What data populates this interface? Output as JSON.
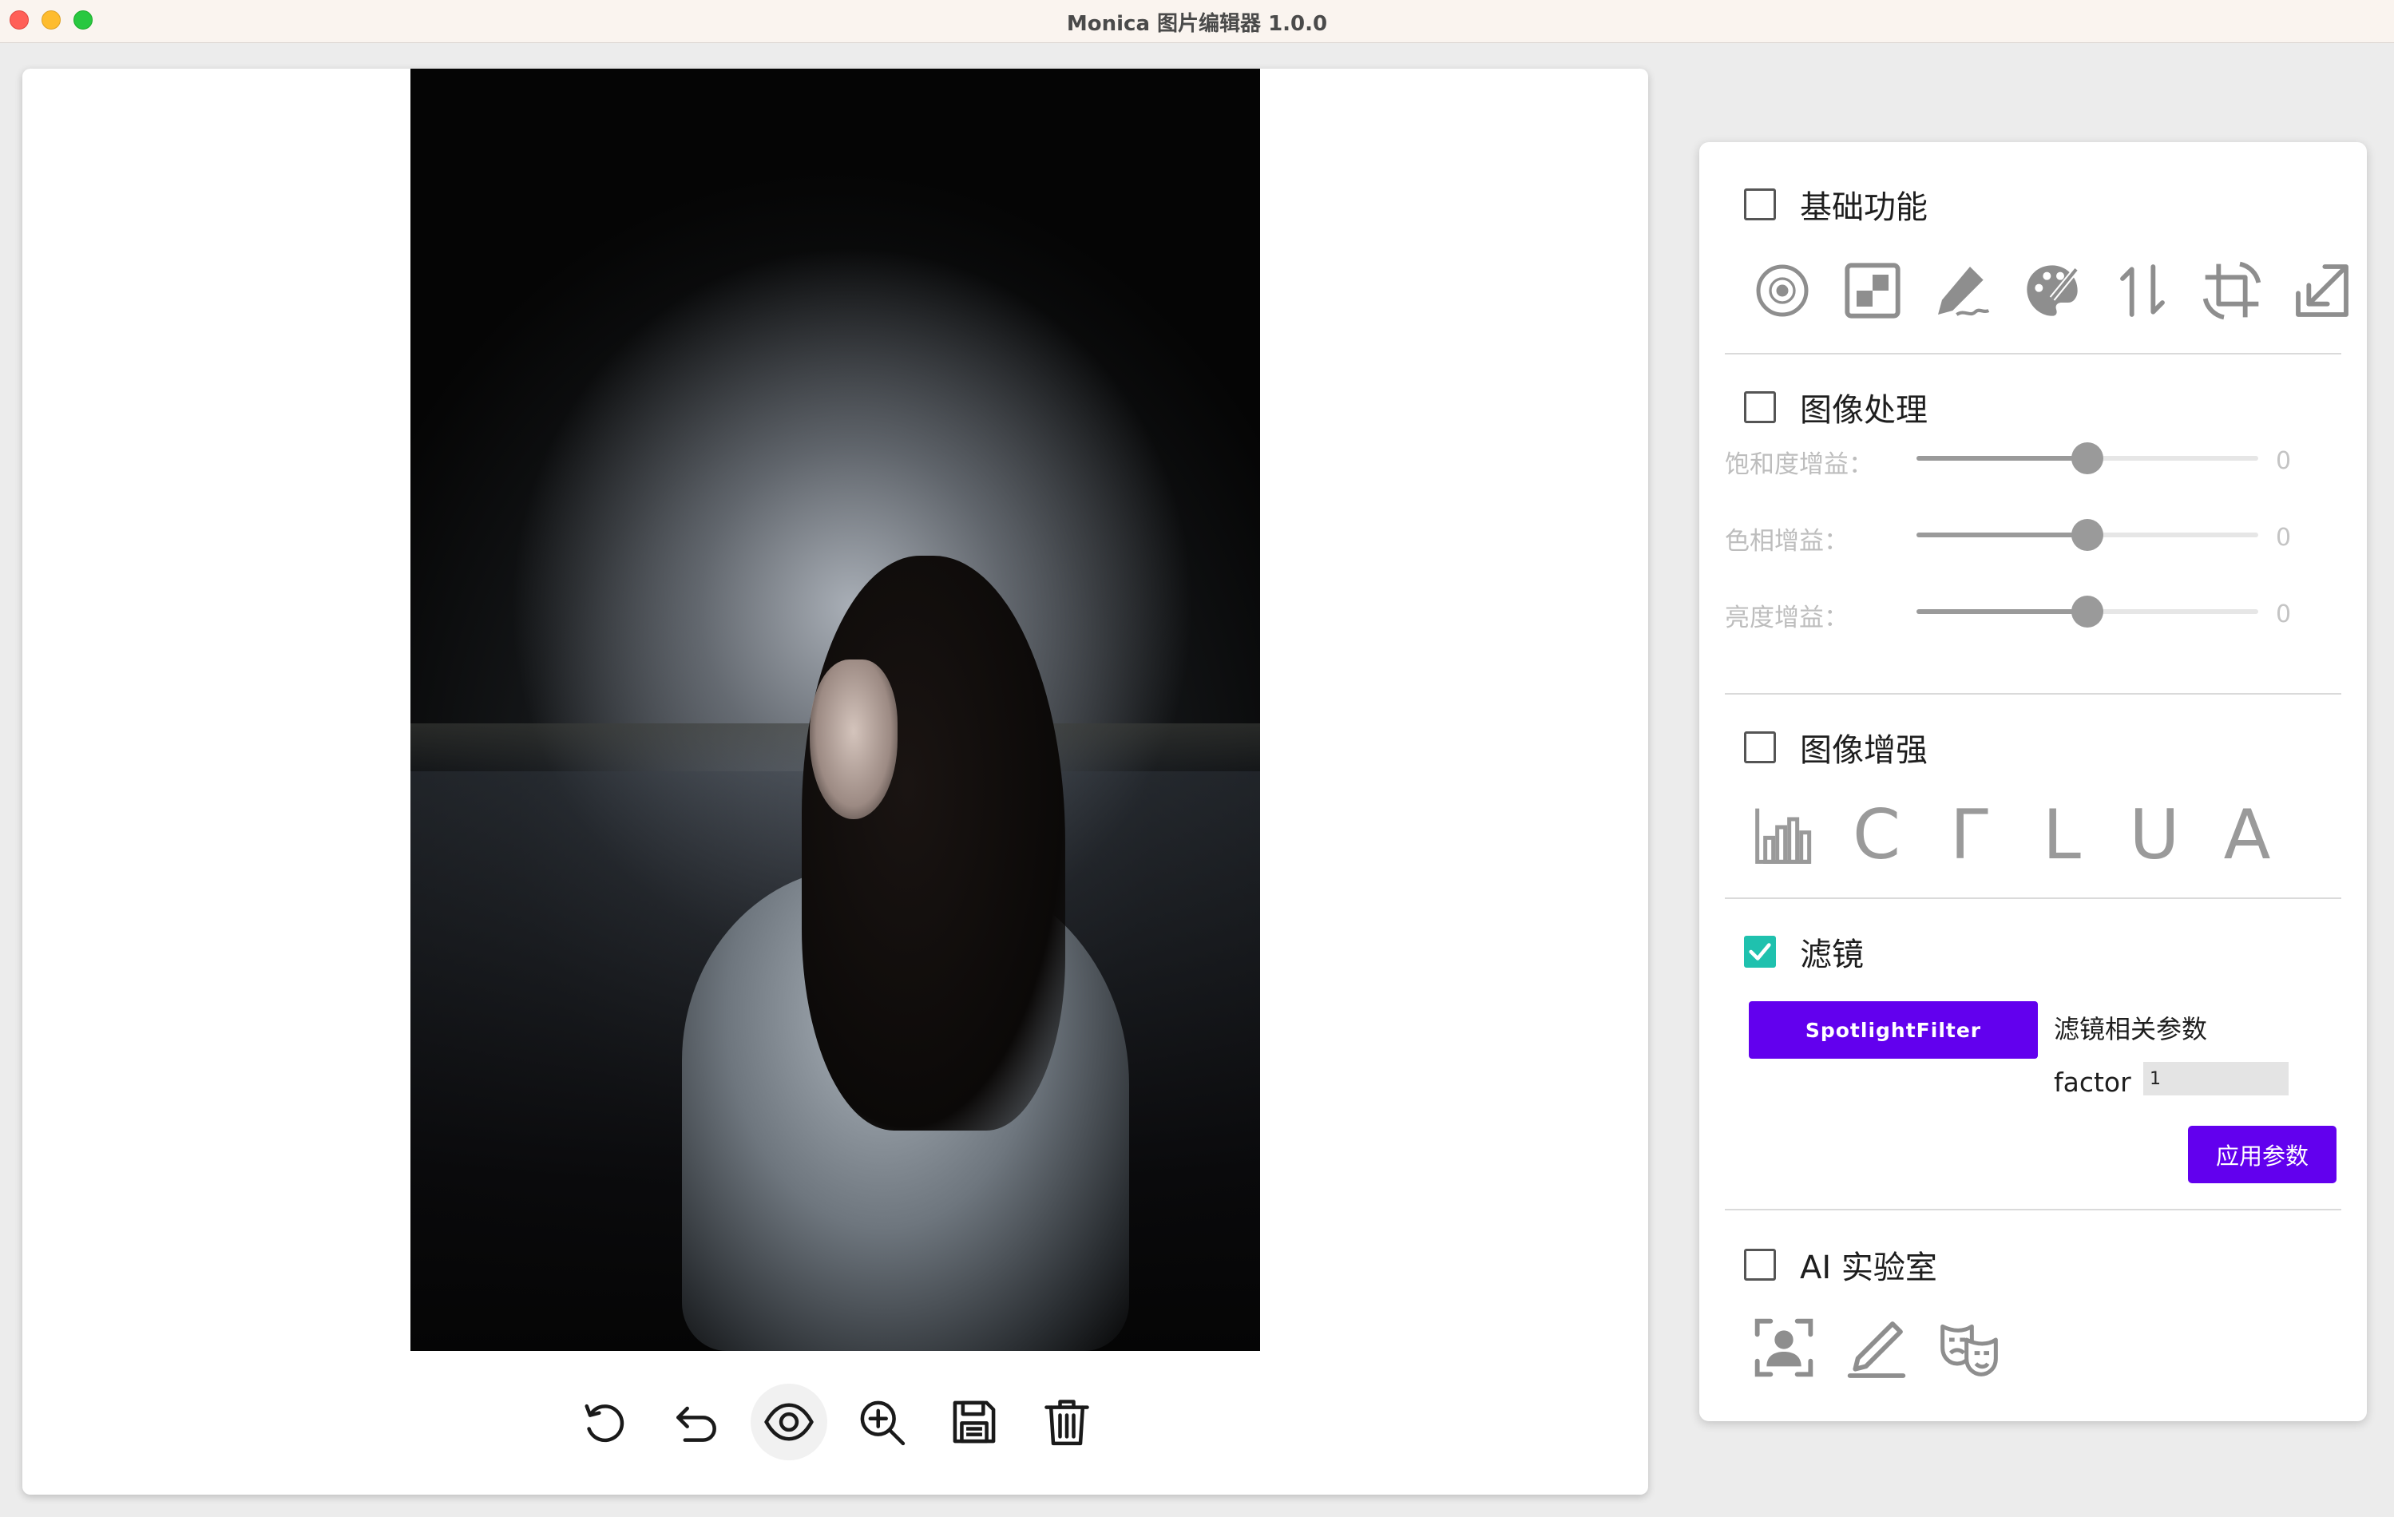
{
  "window": {
    "title": "Monica 图片编辑器 1.0.0"
  },
  "toolbar": {
    "buttons": [
      {
        "icon": "rotate-icon"
      },
      {
        "icon": "undo-icon"
      },
      {
        "icon": "eye-icon"
      },
      {
        "icon": "zoom-in-icon"
      },
      {
        "icon": "save-icon"
      },
      {
        "icon": "trash-icon"
      }
    ]
  },
  "panel": {
    "basic": {
      "title": "基础功能",
      "checked": false,
      "icons": [
        "color-picker-icon",
        "grid-icon",
        "draw-icon",
        "palette-icon",
        "flip-icon",
        "crop-icon",
        "resize-icon"
      ]
    },
    "processing": {
      "title": "图像处理",
      "checked": false,
      "sliders": [
        {
          "label": "饱和度增益：",
          "value": "0",
          "position": 0.5
        },
        {
          "label": "色相增益：",
          "value": "0",
          "position": 0.5
        },
        {
          "label": "亮度增益：",
          "value": "0",
          "position": 0.5
        }
      ]
    },
    "enhance": {
      "title": "图像增强",
      "checked": false,
      "icons": [
        "histogram-icon",
        "C",
        "Γ",
        "L",
        "U",
        "A"
      ]
    },
    "filter": {
      "title": "滤镜",
      "checked": true,
      "selected_filter": "SpotlightFilter",
      "params_label": "滤镜相关参数",
      "factor_label": "factor",
      "factor_value": "1",
      "apply_label": "应用参数"
    },
    "ai": {
      "title": "AI 实验室",
      "checked": false,
      "icons": [
        "face-detect-icon",
        "sketch-icon",
        "masks-icon"
      ]
    }
  },
  "colors": {
    "accent": "#6200ee",
    "checkbox_checked": "#1fc1ae"
  }
}
